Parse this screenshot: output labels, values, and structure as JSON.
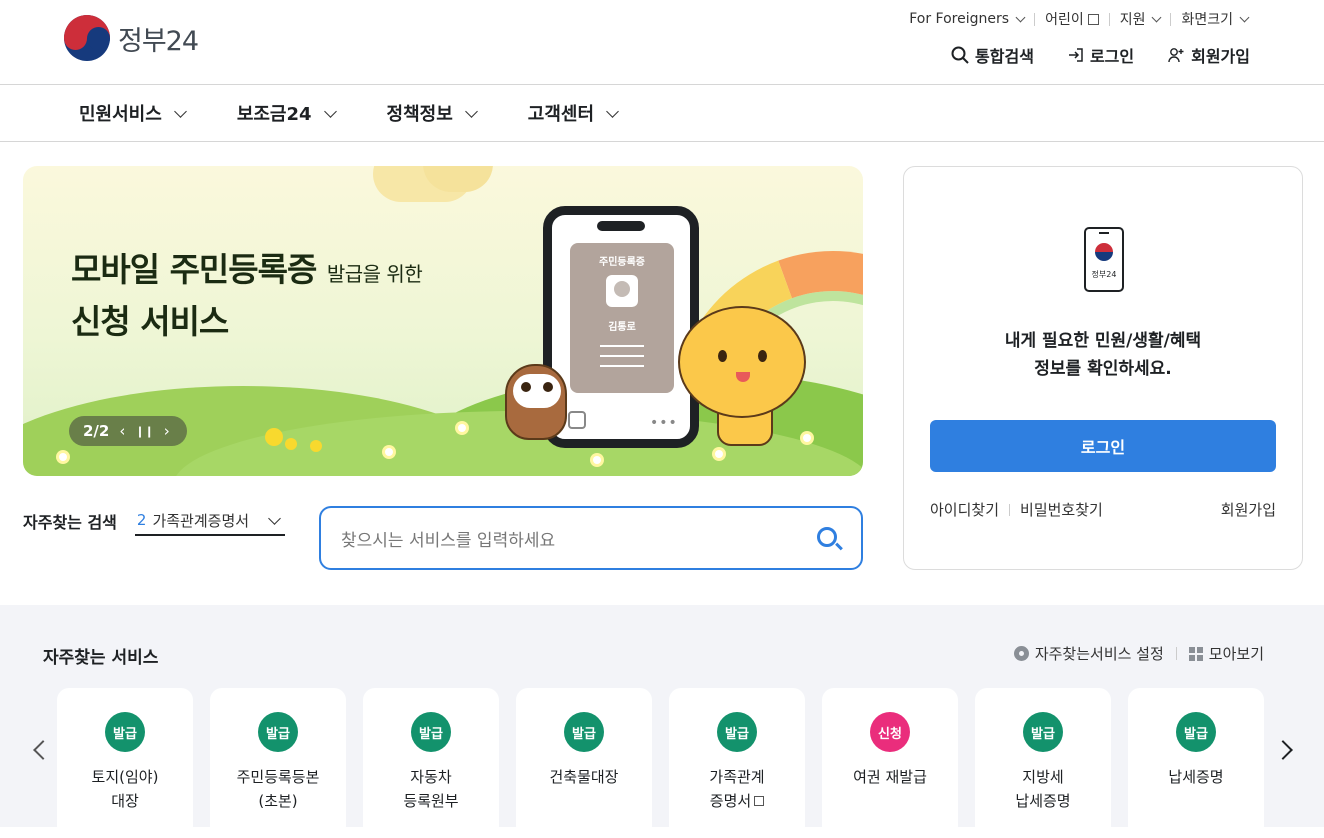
{
  "header": {
    "logo_text": "정부24",
    "util_links": [
      {
        "label": "For Foreigners"
      },
      {
        "label": "어린이"
      },
      {
        "label": "지원"
      },
      {
        "label": "화면크기"
      }
    ],
    "top_links": [
      {
        "label": "통합검색",
        "icon": "search-icon"
      },
      {
        "label": "로그인",
        "icon": "login-icon"
      },
      {
        "label": "회원가입",
        "icon": "add-user-icon"
      }
    ]
  },
  "nav": {
    "items": [
      {
        "label": "민원서비스"
      },
      {
        "label": "보조금24"
      },
      {
        "label": "정책정보"
      },
      {
        "label": "고객센터"
      }
    ]
  },
  "banner": {
    "title_line1": "모바일 주민등록증",
    "title_line1_small": "발급을 위한",
    "title_line2": "신청 서비스",
    "card_title": "주민등록증",
    "card_name": "김통로",
    "pager": "2/2"
  },
  "login_panel": {
    "device_text": "정부24",
    "message_line1": "내게 필요한 민원/생활/혜택",
    "message_line2": "정보를 확인하세요.",
    "login_button": "로그인",
    "find_id": "아이디찾기",
    "find_pw": "비밀번호찾기",
    "signup": "회원가입"
  },
  "frequent_search": {
    "label": "자주찾는 검색",
    "selected_number": "2",
    "selected_value": "가족관계증명서",
    "placeholder": "찾으시는 서비스를 입력하세요"
  },
  "services": {
    "title": "자주찾는 서비스",
    "settings_label": "자주찾는서비스 설정",
    "view_all_label": "모아보기",
    "items": [
      {
        "badge": "발급",
        "line1": "토지(임야)",
        "line2": "대장"
      },
      {
        "badge": "발급",
        "line1": "주민등록등본",
        "line2": "(초본)"
      },
      {
        "badge": "발급",
        "line1": "자동차",
        "line2": "등록원부"
      },
      {
        "badge": "발급",
        "line1": "건축물대장",
        "line2": ""
      },
      {
        "badge": "발급",
        "line1": "가족관계",
        "line2": "증명서"
      },
      {
        "badge": "신청",
        "line1": "여권 재발급",
        "line2": ""
      },
      {
        "badge": "발급",
        "line1": "지방세",
        "line2": "납세증명"
      },
      {
        "badge": "발급",
        "line1": "납세증명",
        "line2": ""
      }
    ]
  },
  "colors": {
    "primary": "#2f7fe0",
    "issue_badge": "#13926c",
    "apply_badge": "#ea2d7c"
  }
}
